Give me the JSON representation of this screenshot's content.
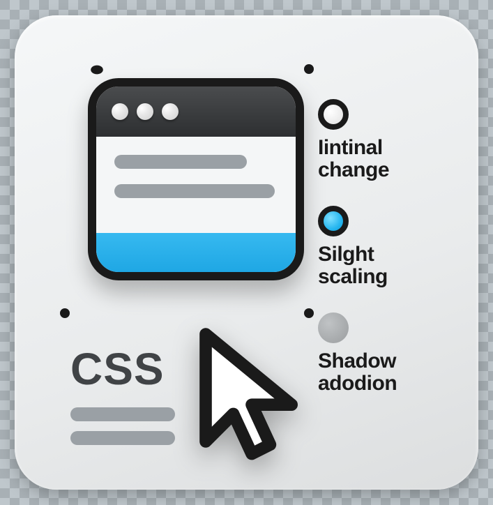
{
  "label": {
    "css": "CSS"
  },
  "legend": {
    "items": [
      {
        "line1": "Iintinal",
        "line2": "change"
      },
      {
        "line1": "Silght",
        "line2": "scaling"
      },
      {
        "line1": "Shadow",
        "line2": "adodion"
      }
    ]
  },
  "icons": {
    "cursor": "cursor-icon",
    "window": "browser-window-icon"
  }
}
